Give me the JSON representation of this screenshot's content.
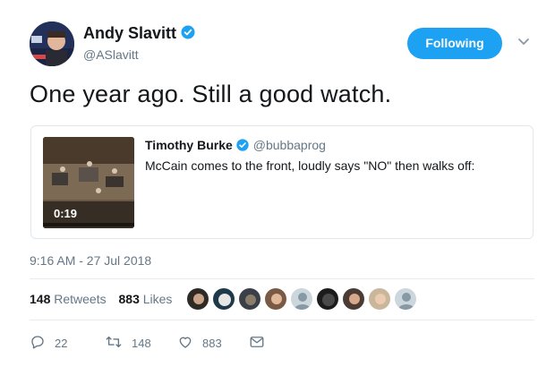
{
  "author": {
    "display_name": "Andy Slavitt",
    "handle": "@ASlavitt",
    "follow_label": "Following"
  },
  "tweet": {
    "text": "One year ago. Still a good watch.",
    "timestamp": "9:16 AM - 27 Jul 2018"
  },
  "quoted": {
    "display_name": "Timothy Burke",
    "handle": "@bubbaprog",
    "text": "McCain comes to the front, loudly says \"NO\" then walks off:",
    "video_duration": "0:19"
  },
  "stats": {
    "retweets_count": "148",
    "retweets_label": "Retweets",
    "likes_count": "883",
    "likes_label": "Likes"
  },
  "actions": {
    "replies": "22",
    "retweets": "148",
    "likes": "883"
  },
  "colors": {
    "accent": "#1da1f2",
    "muted": "#657786",
    "text": "#14171a",
    "border": "#e1e8ed"
  }
}
